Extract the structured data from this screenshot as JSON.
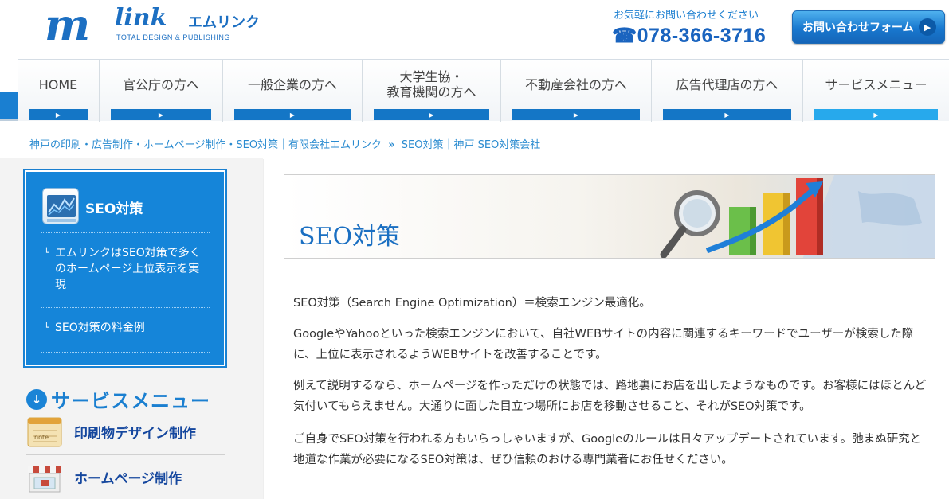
{
  "header": {
    "logo_m": "m",
    "logo_link": "link",
    "logo_kana": "エムリンク",
    "logo_sub": "TOTAL DESIGN & PUBLISHING",
    "contact_lead": "お気軽にお問い合わせください",
    "phone": "☎078-366-3716",
    "form_button": "お問い合わせフォーム"
  },
  "nav": {
    "items": [
      {
        "label": "HOME"
      },
      {
        "label": "官公庁の方へ"
      },
      {
        "label": "一般企業の方へ"
      },
      {
        "label": "大学生協・\n教育機関の方へ"
      },
      {
        "label": "不動産会社の方へ"
      },
      {
        "label": "広告代理店の方へ"
      },
      {
        "label": "サービスメニュー"
      }
    ],
    "arrow": "▶"
  },
  "breadcrumb": {
    "home": "神戸の印刷・広告制作・ホームページ制作・SEO対策｜有限会社エムリンク",
    "separator": "»",
    "current": "SEO対策｜神戸 SEO対策会社"
  },
  "sidebar": {
    "title": "SEO対策",
    "hook": "└",
    "links": [
      {
        "label": "エムリンクはSEO対策で多くのホームページ上位表示を実現"
      },
      {
        "label": "SEO対策の料金例"
      }
    ]
  },
  "service_menu": {
    "heading": "サービスメニュー",
    "items": [
      {
        "label": "印刷物デザイン制作",
        "icon": "note-pad-icon"
      },
      {
        "label": "ホームページ制作",
        "icon": "storefront-icon"
      }
    ],
    "icon_note_text": "note"
  },
  "main": {
    "hero_title": "SEO対策",
    "paragraphs": [
      "SEO対策（Search Engine Optimization）＝検索エンジン最適化。",
      "GoogleやYahooといった検索エンジンにおいて、自社WEBサイトの内容に関連するキーワードでユーザーが検索した際に、上位に表示されるようWEBサイトを改善することです。",
      "例えて説明するなら、ホームページを作っただけの状態では、路地裏にお店を出したようなものです。お客様にはほとんど気付いてもらえません。大通りに面した目立つ場所にお店を移動させること、それがSEO対策です。",
      "ご自身でSEO対策を行われる方もいらっしゃいますが、Googleのルールは日々アップデートされています。弛まぬ研究と地道な作業が必要になるSEO対策は、ぜひ信頼のおける専門業者にお任せください。"
    ]
  },
  "colors": {
    "brand_blue": "#1585d9",
    "nav_bar": "#1476c6",
    "nav_bar_active": "#27a9ec",
    "link": "#2a8bd0",
    "service_label": "#15479e"
  }
}
